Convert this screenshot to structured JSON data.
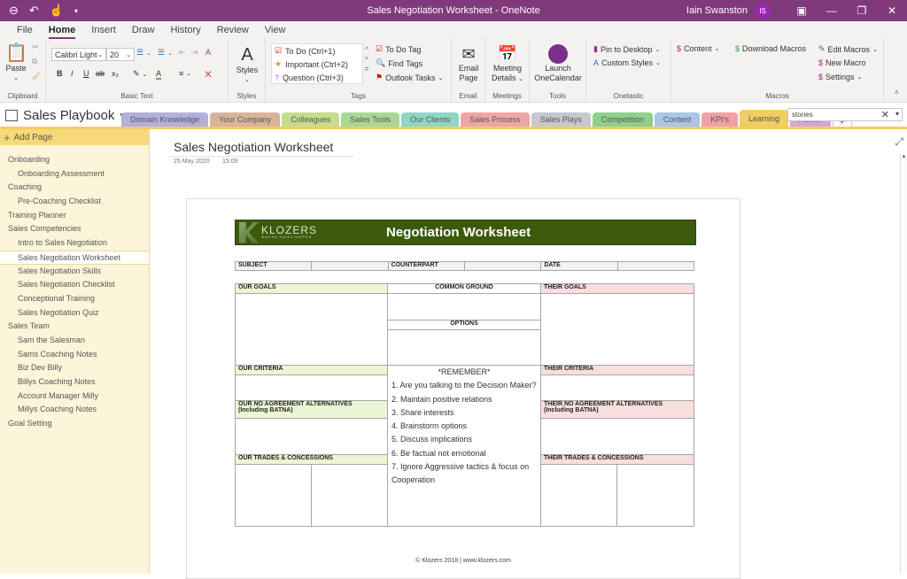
{
  "titlebar": {
    "title": "Sales Negotiation Worksheet  -  OneNote",
    "user": "Iain Swanston",
    "avatar_initials": "IS"
  },
  "menu": [
    "File",
    "Home",
    "Insert",
    "Draw",
    "History",
    "Review",
    "View"
  ],
  "ribbon": {
    "clipboard": {
      "paste": "Paste",
      "label": "Clipboard"
    },
    "basic_text": {
      "font": "Calibri Light",
      "size": "20",
      "label": "Basic Text",
      "bold": "B",
      "italic": "I",
      "underline": "U",
      "strike": "ab",
      "subscript": "x₂"
    },
    "styles": {
      "button": "Styles",
      "label": "Styles"
    },
    "tags": {
      "items": [
        "To Do (Ctrl+1)",
        "Important (Ctrl+2)",
        "Question (Ctrl+3)"
      ],
      "todo_tag": "To Do Tag",
      "find_tags": "Find Tags",
      "outlook_tasks": "Outlook Tasks",
      "label": "Tags"
    },
    "email": {
      "button_line1": "Email",
      "button_line2": "Page",
      "label": "Email"
    },
    "meetings": {
      "button_line1": "Meeting",
      "button_line2": "Details",
      "label": "Meetings"
    },
    "tools": {
      "button_line1": "Launch",
      "button_line2": "OneCalendar",
      "label": "Tools"
    },
    "onetastic": {
      "pin": "Pin to Desktop",
      "custom_styles": "Custom Styles",
      "label": "Onetastic"
    },
    "macros": {
      "content": "Content",
      "download": "Download Macros",
      "edit": "Edit Macros",
      "new": "New Macro",
      "settings": "Settings",
      "label": "Macros"
    }
  },
  "notebook": {
    "name": "Sales Playbook",
    "tabs": [
      {
        "label": "Domain Knowledge",
        "color": "#b3b0dc"
      },
      {
        "label": "Your Company",
        "color": "#d9b49a"
      },
      {
        "label": "Colleagues",
        "color": "#c6dc8e"
      },
      {
        "label": "Sales Tools",
        "color": "#a9d896"
      },
      {
        "label": "Our Clients",
        "color": "#8fd6c6"
      },
      {
        "label": "Sales Process",
        "color": "#f0a6a6"
      },
      {
        "label": "Sales Plays",
        "color": "#c5c9cf"
      },
      {
        "label": "Competition",
        "color": "#8ed08e"
      },
      {
        "label": "Content",
        "color": "#a9c5e8"
      },
      {
        "label": "KPI's",
        "color": "#f2a0a8"
      },
      {
        "label": "Learning",
        "color": "#f2cd60"
      },
      {
        "label": "Admin",
        "color": "#d5a6d8"
      }
    ],
    "active_tab": "Learning",
    "add_tab": "+",
    "search_value": "stories"
  },
  "sidebar": {
    "add_page": "Add Page",
    "pages": [
      {
        "label": "Onboarding",
        "level": 0
      },
      {
        "label": "Onboarding Assessment",
        "level": 1
      },
      {
        "label": "Coaching",
        "level": 0
      },
      {
        "label": "Pre-Coaching Checklist",
        "level": 1
      },
      {
        "label": "Training Planner",
        "level": 0
      },
      {
        "label": "Sales Competencies",
        "level": 0
      },
      {
        "label": "Intro to Sales Negotiation",
        "level": 1
      },
      {
        "label": "Sales Negotiation Worksheet",
        "level": 1,
        "selected": true
      },
      {
        "label": "Sales Negotiation Skills",
        "level": 1
      },
      {
        "label": "Sales Negotiation Checklist",
        "level": 1
      },
      {
        "label": "Conceptional Training",
        "level": 1
      },
      {
        "label": "Sales Negotiation Quiz",
        "level": 1
      },
      {
        "label": "Sales Team",
        "level": 0
      },
      {
        "label": "Sam the Salesman",
        "level": 1
      },
      {
        "label": "Sams Coaching Notes",
        "level": 1
      },
      {
        "label": "Biz Dev Billy",
        "level": 1
      },
      {
        "label": "Billys Coaching Notes",
        "level": 1
      },
      {
        "label": "Account Manager Milly",
        "level": 1
      },
      {
        "label": "Millys Coaching Notes",
        "level": 1
      },
      {
        "label": "Goal Setting",
        "level": 0
      }
    ]
  },
  "page": {
    "title": "Sales Negotiation Worksheet",
    "date": "25 May 2020",
    "time": "15:09"
  },
  "worksheet": {
    "brand": "KLOZERS",
    "brand_tagline": "MAKING SALES HAPPEN",
    "title": "Negotiation Worksheet",
    "info": {
      "subject": "SUBJECT",
      "counterpart": "COUNTERPART",
      "date": "DATE"
    },
    "our_goals": "OUR GOALS",
    "common_ground": "COMMON GROUND",
    "their_goals": "THEIR GOALS",
    "options": "OPTIONS",
    "our_criteria": "OUR CRITERIA",
    "remember": "*REMEMBER*",
    "their_criteria": "THEIR CRITERIA",
    "our_alternatives_1": "OUR NO AGREEMENT ALTERNATIVES",
    "our_alternatives_2": "(Including BATNA)",
    "their_alternatives_1": "THEIR NO AGREEMENT ALTERNATIVES",
    "their_alternatives_2": "(Including BATNA)",
    "our_trades": "OUR TRADES & CONCESSIONS",
    "their_trades": "THEIR TRADES & CONCESSIONS",
    "remember_items": [
      "1. Are you talking to the Decision Maker?",
      "2. Maintain positive relations",
      "3. Share interests",
      "4. Brainstorm options",
      "5. Discuss implications",
      "6. Be factual not emotional",
      "7. Ignore Aggressive tactics & focus on Cooperation"
    ],
    "footer": "© Klozers 2018 | www.klozers.com"
  }
}
